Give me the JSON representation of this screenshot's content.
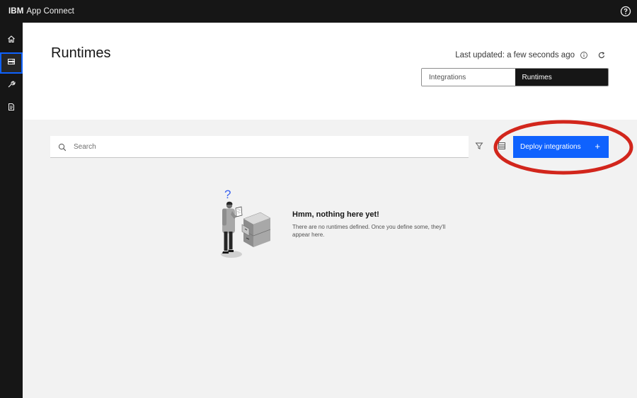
{
  "topbar": {
    "brand_prefix": "IBM",
    "brand_name": "App Connect",
    "help_icon": "help-icon"
  },
  "sidenav": {
    "items": [
      {
        "icon": "home-icon"
      },
      {
        "icon": "runtimes-icon",
        "active": true
      },
      {
        "icon": "wrench-icon"
      },
      {
        "icon": "document-icon"
      }
    ]
  },
  "header": {
    "title": "Runtimes",
    "last_updated": "Last updated: a few seconds ago",
    "tabs": [
      {
        "label": "Integrations"
      },
      {
        "label": "Runtimes",
        "active": true
      }
    ]
  },
  "toolbar": {
    "search_placeholder": "Search",
    "deploy_label": "Deploy integrations",
    "deploy_plus": "+"
  },
  "empty_state": {
    "question_mark": "?",
    "title": "Hmm, nothing here yet!",
    "description": "There are no runtimes defined. Once you define some, they'll appear here."
  },
  "colors": {
    "accent": "#0f62fe",
    "nav_bg": "#161616",
    "annotation": "#d2261c"
  }
}
